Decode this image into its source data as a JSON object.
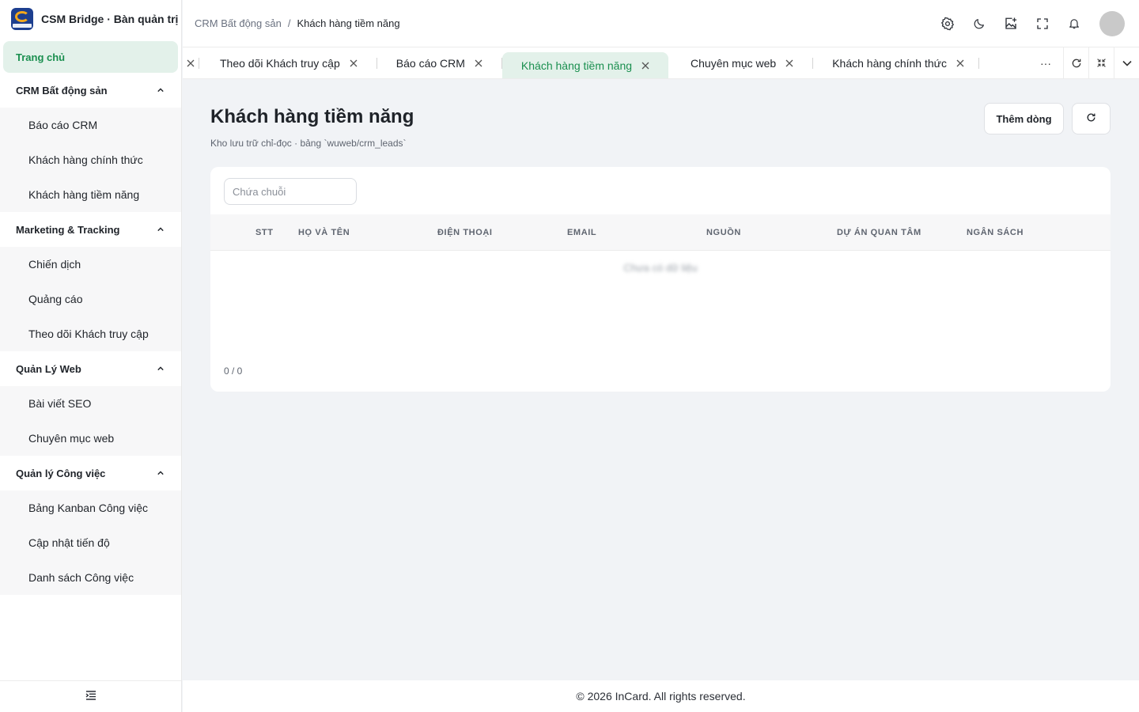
{
  "brand": {
    "title": "CSM Bridge · Bàn quản trị"
  },
  "sidebar": {
    "home": "Trang chủ",
    "groups": [
      {
        "label": "CRM Bất động sản",
        "items": [
          "Báo cáo CRM",
          "Khách hàng chính thức",
          "Khách hàng tiềm năng"
        ]
      },
      {
        "label": "Marketing & Tracking",
        "items": [
          "Chiến dịch",
          "Quảng cáo",
          "Theo dõi Khách truy cập"
        ]
      },
      {
        "label": "Quản Lý Web",
        "items": [
          "Bài viết SEO",
          "Chuyên mục web"
        ]
      },
      {
        "label": "Quản lý Công việc",
        "items": [
          "Bảng Kanban Công việc",
          "Cập nhật tiến độ",
          "Danh sách Công việc"
        ]
      }
    ]
  },
  "header": {
    "breadcrumb_parent": "CRM Bất động sản",
    "breadcrumb_sep": "/",
    "breadcrumb_current": "Khách hàng tiềm năng"
  },
  "tabs": [
    {
      "label": "Theo dõi Khách truy cập"
    },
    {
      "label": "Báo cáo CRM"
    },
    {
      "label": "Khách hàng tiềm năng",
      "active": true
    },
    {
      "label": "Chuyên mục web"
    },
    {
      "label": "Khách hàng chính thức"
    }
  ],
  "tab_more": "···",
  "page": {
    "title": "Khách hàng tiềm năng",
    "subtitle": "Kho lưu trữ chỉ-đọc · bảng `wuweb/crm_leads`",
    "add_button": "Thêm dòng"
  },
  "table": {
    "search_placeholder": "Chứa chuỗi",
    "columns": [
      "STT",
      "HỌ VÀ TÊN",
      "ĐIỆN THOẠI",
      "EMAIL",
      "NGUỒN",
      "DỰ ÁN QUAN TÂM",
      "NGÂN SÁCH"
    ],
    "empty_text": "Chưa có dữ liệu",
    "pagination": "0 / 0"
  },
  "footer": {
    "text": "© 2026 InCard. All rights reserved."
  },
  "colors": {
    "accent": "#1a8f4f",
    "accent_bg": "#e3f1ea",
    "brand_blue": "#1d3f8f",
    "brand_gold": "#f3a81c"
  }
}
